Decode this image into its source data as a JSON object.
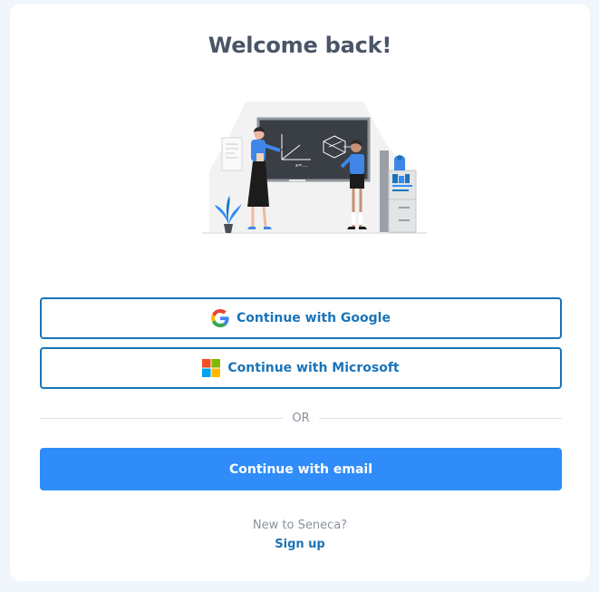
{
  "page": {
    "title": "Welcome back!"
  },
  "buttons": {
    "google_label": "Continue with Google",
    "google_icon": "google-logo-icon",
    "microsoft_label": "Continue with Microsoft",
    "microsoft_icon": "microsoft-logo-icon",
    "email_label": "Continue with email"
  },
  "divider": {
    "text": "OR"
  },
  "footer": {
    "prompt": "New to Seneca?",
    "signup_link": "Sign up"
  },
  "colors": {
    "accent_blue": "#1a74b8",
    "primary_button": "#2f8cf8",
    "title_text": "#4a5567",
    "muted_text": "#8a919c",
    "background": "#f1f6fd",
    "card": "#ffffff"
  },
  "illustration": {
    "description_icon": "classroom-teacher-illustration"
  }
}
